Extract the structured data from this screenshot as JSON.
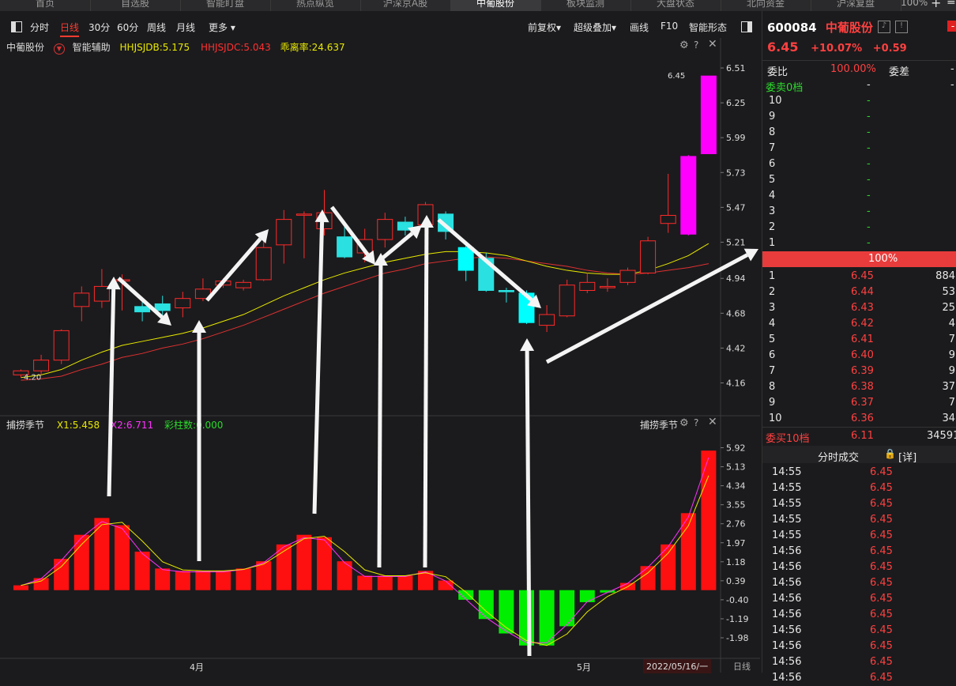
{
  "top_tabs": [
    "首页",
    "自选股",
    "智能盯盘",
    "热点纵览",
    "沪深京A股",
    "中葡股份",
    "板块监测",
    "大盘状态",
    "北向资金",
    "沪深复盘"
  ],
  "window": {
    "zoom": "100%"
  },
  "toolbar": {
    "items": [
      "分时",
      "日线",
      "30分",
      "60分",
      "周线",
      "月线",
      "更多"
    ],
    "active": "日线",
    "right": [
      "前复权",
      "超级叠加",
      "画线",
      "F10",
      "智能形态"
    ]
  },
  "main_legend": {
    "name": "中葡股份",
    "aux": "智能辅助",
    "hhjsjdb": "HHJSJDB:5.175",
    "hhjsjdc": "HHJSJDC:5.043",
    "ratio": "乖离率:24.637"
  },
  "price_axis": [
    "6.51",
    "6.25",
    "5.99",
    "5.73",
    "5.47",
    "5.21",
    "4.94",
    "4.68",
    "4.42",
    "4.16"
  ],
  "low_label": "4.20",
  "high_label": "6.45",
  "sub_legend": {
    "name": "捕捞季节",
    "x1": "X1:5.458",
    "x2": "X2:6.711",
    "cai": "彩柱数:0.000",
    "name_right": "捕捞季节"
  },
  "sub_axis": [
    "5.92",
    "5.13",
    "4.34",
    "3.55",
    "2.76",
    "1.97",
    "1.18",
    "0.39",
    "-0.40",
    "-1.19",
    "-1.98"
  ],
  "x_axis": {
    "apr": "4月",
    "may": "5月",
    "date": "2022/05/16/一",
    "period": "日线"
  },
  "chart_data": {
    "type": "candlestick",
    "ylim": [
      4.05,
      6.6
    ],
    "candles": [
      {
        "o": 4.22,
        "c": 4.25,
        "h": 4.26,
        "l": 4.2
      },
      {
        "o": 4.25,
        "c": 4.33,
        "h": 4.37,
        "l": 4.22
      },
      {
        "o": 4.33,
        "c": 4.55,
        "h": 4.56,
        "l": 4.3
      },
      {
        "o": 4.73,
        "c": 4.83,
        "h": 4.88,
        "l": 4.62
      },
      {
        "o": 4.77,
        "c": 4.88,
        "h": 5.01,
        "l": 4.72
      },
      {
        "o": 4.92,
        "c": 4.93,
        "h": 4.97,
        "l": 4.7
      },
      {
        "o": 4.73,
        "c": 4.69,
        "h": 4.8,
        "l": 4.62
      },
      {
        "o": 4.75,
        "c": 4.7,
        "h": 4.81,
        "l": 4.64
      },
      {
        "o": 4.72,
        "c": 4.79,
        "h": 4.84,
        "l": 4.65
      },
      {
        "o": 4.79,
        "c": 4.86,
        "h": 4.94,
        "l": 4.77
      },
      {
        "o": 4.89,
        "c": 4.92,
        "h": 4.94,
        "l": 4.87
      },
      {
        "o": 4.87,
        "c": 4.91,
        "h": 4.93,
        "l": 4.85
      },
      {
        "o": 4.93,
        "c": 5.17,
        "h": 5.23,
        "l": 4.92
      },
      {
        "o": 5.19,
        "c": 5.38,
        "h": 5.45,
        "l": 5.05
      },
      {
        "o": 5.42,
        "c": 5.42,
        "h": 5.44,
        "l": 5.09
      },
      {
        "o": 5.31,
        "c": 5.43,
        "h": 5.6,
        "l": 5.26
      },
      {
        "o": 5.25,
        "c": 5.1,
        "h": 5.35,
        "l": 5.09
      },
      {
        "o": 5.13,
        "c": 5.23,
        "h": 5.31,
        "l": 5.06
      },
      {
        "o": 5.23,
        "c": 5.38,
        "h": 5.43,
        "l": 5.17
      },
      {
        "o": 5.36,
        "c": 5.3,
        "h": 5.4,
        "l": 5.26
      },
      {
        "o": 5.34,
        "c": 5.49,
        "h": 5.51,
        "l": 5.3
      },
      {
        "o": 5.42,
        "c": 5.29,
        "h": 5.44,
        "l": 5.23
      },
      {
        "o": 5.17,
        "c": 5.0,
        "h": 5.19,
        "l": 4.92
      },
      {
        "o": 5.09,
        "c": 4.85,
        "h": 5.13,
        "l": 4.84
      },
      {
        "o": 4.85,
        "c": 4.84,
        "h": 4.87,
        "l": 4.76
      },
      {
        "o": 4.83,
        "c": 4.61,
        "h": 4.85,
        "l": 4.6
      },
      {
        "o": 4.59,
        "c": 4.67,
        "h": 4.74,
        "l": 4.54
      },
      {
        "o": 4.66,
        "c": 4.89,
        "h": 4.93,
        "l": 4.65
      },
      {
        "o": 4.85,
        "c": 4.91,
        "h": 4.98,
        "l": 4.83
      },
      {
        "o": 4.87,
        "c": 4.88,
        "h": 4.94,
        "l": 4.84
      },
      {
        "o": 4.91,
        "c": 5.0,
        "h": 5.02,
        "l": 4.89
      },
      {
        "o": 4.98,
        "c": 5.22,
        "h": 5.25,
        "l": 4.97
      },
      {
        "o": 5.35,
        "c": 5.41,
        "h": 5.72,
        "l": 5.28
      },
      {
        "o": 5.85,
        "c": 5.27,
        "h": 5.86,
        "l": 5.26
      },
      {
        "o": 5.87,
        "c": 6.45,
        "h": 6.45,
        "l": 5.87
      }
    ],
    "ma_yellow": [
      4.2,
      4.22,
      4.26,
      4.33,
      4.39,
      4.44,
      4.47,
      4.5,
      4.53,
      4.57,
      4.62,
      4.67,
      4.74,
      4.81,
      4.87,
      4.93,
      4.98,
      5.02,
      5.06,
      5.09,
      5.12,
      5.14,
      5.14,
      5.13,
      5.11,
      5.07,
      5.03,
      5.0,
      4.98,
      4.97,
      4.97,
      5.0,
      5.05,
      5.11,
      5.2
    ],
    "ma_red": [
      4.18,
      4.19,
      4.21,
      4.26,
      4.3,
      4.35,
      4.38,
      4.42,
      4.45,
      4.49,
      4.54,
      4.59,
      4.65,
      4.71,
      4.77,
      4.83,
      4.88,
      4.93,
      4.98,
      5.01,
      5.05,
      5.07,
      5.09,
      5.1,
      5.09,
      5.07,
      5.05,
      5.03,
      5.0,
      4.98,
      4.97,
      4.98,
      5.0,
      5.02,
      5.05
    ],
    "sub_bars": [
      0.2,
      0.5,
      1.3,
      2.3,
      3.0,
      2.7,
      1.6,
      0.9,
      0.8,
      0.8,
      0.8,
      0.9,
      1.2,
      1.9,
      2.3,
      2.2,
      1.2,
      0.6,
      0.6,
      0.6,
      0.8,
      0.4,
      -0.4,
      -1.2,
      -1.8,
      -2.3,
      -2.3,
      -1.5,
      -0.5,
      -0.1,
      0.3,
      1.0,
      1.9,
      3.2,
      5.8
    ],
    "sub_ylim": [
      -2.3,
      6.3
    ]
  },
  "right": {
    "code": "600084",
    "name": "中葡股份",
    "price": "6.45",
    "pct": "+10.07%",
    "chg": "+0.59",
    "weibi_label": "委比",
    "weibi": "100.00%",
    "weicha_label": "委差",
    "weicha": "-",
    "sell_label": "委卖0档",
    "sell_val": "-",
    "sell_val2": "-",
    "sell_levels": [
      "10",
      "9",
      "8",
      "7",
      "6",
      "5",
      "4",
      "3",
      "2",
      "1"
    ],
    "dash": "-",
    "bar": "100%",
    "buy": [
      {
        "lv": "1",
        "p": "6.45",
        "v": "884"
      },
      {
        "lv": "2",
        "p": "6.44",
        "v": "53"
      },
      {
        "lv": "3",
        "p": "6.43",
        "v": "25"
      },
      {
        "lv": "4",
        "p": "6.42",
        "v": "4"
      },
      {
        "lv": "5",
        "p": "6.41",
        "v": "7"
      },
      {
        "lv": "6",
        "p": "6.40",
        "v": "9"
      },
      {
        "lv": "7",
        "p": "6.39",
        "v": "9"
      },
      {
        "lv": "8",
        "p": "6.38",
        "v": "37"
      },
      {
        "lv": "9",
        "p": "6.37",
        "v": "7"
      },
      {
        "lv": "10",
        "p": "6.36",
        "v": "34"
      }
    ],
    "buy10_label": "委买10档",
    "buy10_price": "6.11",
    "buy10_vol": "34591",
    "ticks_label": "分时成交",
    "ticks_detail": "[详]",
    "ticks": [
      {
        "t": "14:55",
        "p": "6.45"
      },
      {
        "t": "14:55",
        "p": "6.45"
      },
      {
        "t": "14:55",
        "p": "6.45"
      },
      {
        "t": "14:55",
        "p": "6.45"
      },
      {
        "t": "14:55",
        "p": "6.45"
      },
      {
        "t": "14:56",
        "p": "6.45"
      },
      {
        "t": "14:56",
        "p": "6.45"
      },
      {
        "t": "14:56",
        "p": "6.45"
      },
      {
        "t": "14:56",
        "p": "6.45"
      },
      {
        "t": "14:56",
        "p": "6.45"
      },
      {
        "t": "14:56",
        "p": "6.45"
      },
      {
        "t": "14:56",
        "p": "6.45"
      },
      {
        "t": "14:56",
        "p": "6.45"
      },
      {
        "t": "14:56",
        "p": "6.45"
      }
    ]
  }
}
